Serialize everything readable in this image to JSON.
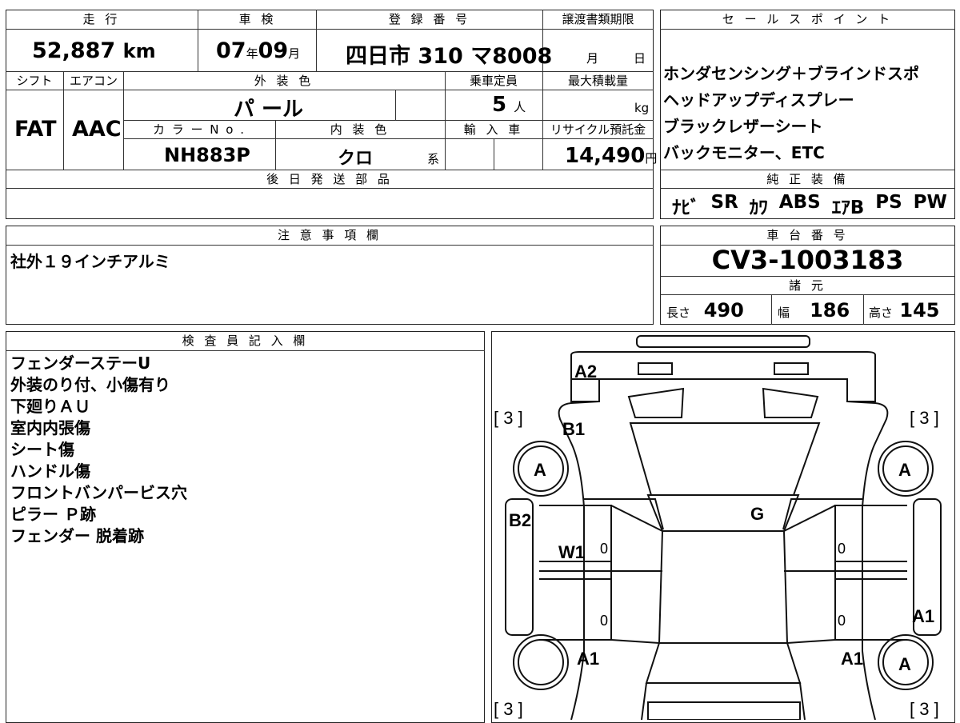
{
  "top": {
    "h_mileage": "走 行",
    "h_shaken": "車 検",
    "h_reg": "登 録 番 号",
    "h_transfer": "譲渡書類期限",
    "mileage": "52,887",
    "km": "km",
    "shaken_year": "07",
    "nen": "年",
    "shaken_month": "09",
    "tsuki": "月",
    "reg_area": "四日市",
    "reg_num": "310",
    "reg_kana": "マ",
    "reg_serial": "8008",
    "transfer_month": "月",
    "transfer_day": "日",
    "h_shift": "シフト",
    "h_ac": "エアコン",
    "h_color": "外 装 色",
    "h_seats": "乗車定員",
    "h_load": "最大積載量",
    "shift": "FAT",
    "ac": "AAC",
    "color": "パ ール",
    "seats": "5",
    "seats_unit": "人",
    "load_unit": "kg",
    "h_colorno": "カ ラ ー N o .",
    "h_interior": "内 装 色",
    "h_import": "輸 入 車",
    "h_recycle": "リサイクル預託金",
    "colorno": "NH883P",
    "interior": "クロ",
    "kei": "系",
    "recycle": "14,490",
    "yen": "円",
    "h_later": "後 日 発 送 部 品"
  },
  "sales": {
    "h": "セ ー ル ス ポ イ ン ト",
    "lines": [
      "ホンダセンシング＋ブラインドスポ",
      "ヘッドアップディスプレー",
      "ブラックレザーシート",
      "バックモニター、ETC"
    ],
    "h_equip": "純 正 装 備",
    "equip": [
      "ﾅﾋﾞ",
      "SR",
      "ｶﾜ",
      "ABS",
      "ｴｱB",
      "PS",
      "PW"
    ]
  },
  "notes": {
    "h": "注 意 事 項 欄",
    "text": "社外１９インチアルミ"
  },
  "chassis": {
    "h": "車 台 番 号",
    "value": "CV3-1003183",
    "h_spec": "諸 元",
    "len_l": "長さ",
    "len": "490",
    "wid_l": "幅",
    "wid": "186",
    "hei_l": "高さ",
    "hei": "145"
  },
  "inspector": {
    "h": "検 査 員 記 入 欄",
    "lines": [
      "フェンダーステーU",
      "外装のり付、小傷有り",
      "下廻りＡＵ",
      "室内内張傷",
      "シート傷",
      "ハンドル傷",
      "フロントバンパービス穴",
      "ピラー Ｐ跡",
      "フェンダー 脱着跡"
    ]
  },
  "diagram": {
    "a2": "A2",
    "b1": "B1",
    "b2": "B2",
    "g": "G",
    "w1": "W1",
    "a1_rr": "A1",
    "a1_rl": "A1",
    "a1_r": "A1",
    "tire_fl": "A",
    "tire_fr": "A",
    "tire_rr": "A",
    "tread_fl": "[ 3 ]",
    "tread_fr": "[ 3 ]",
    "tread_rl": "[ 3 ]",
    "tread_rr": "[ 3 ]",
    "z1": "0",
    "z2": "0",
    "z3": "0",
    "z4": "0"
  }
}
